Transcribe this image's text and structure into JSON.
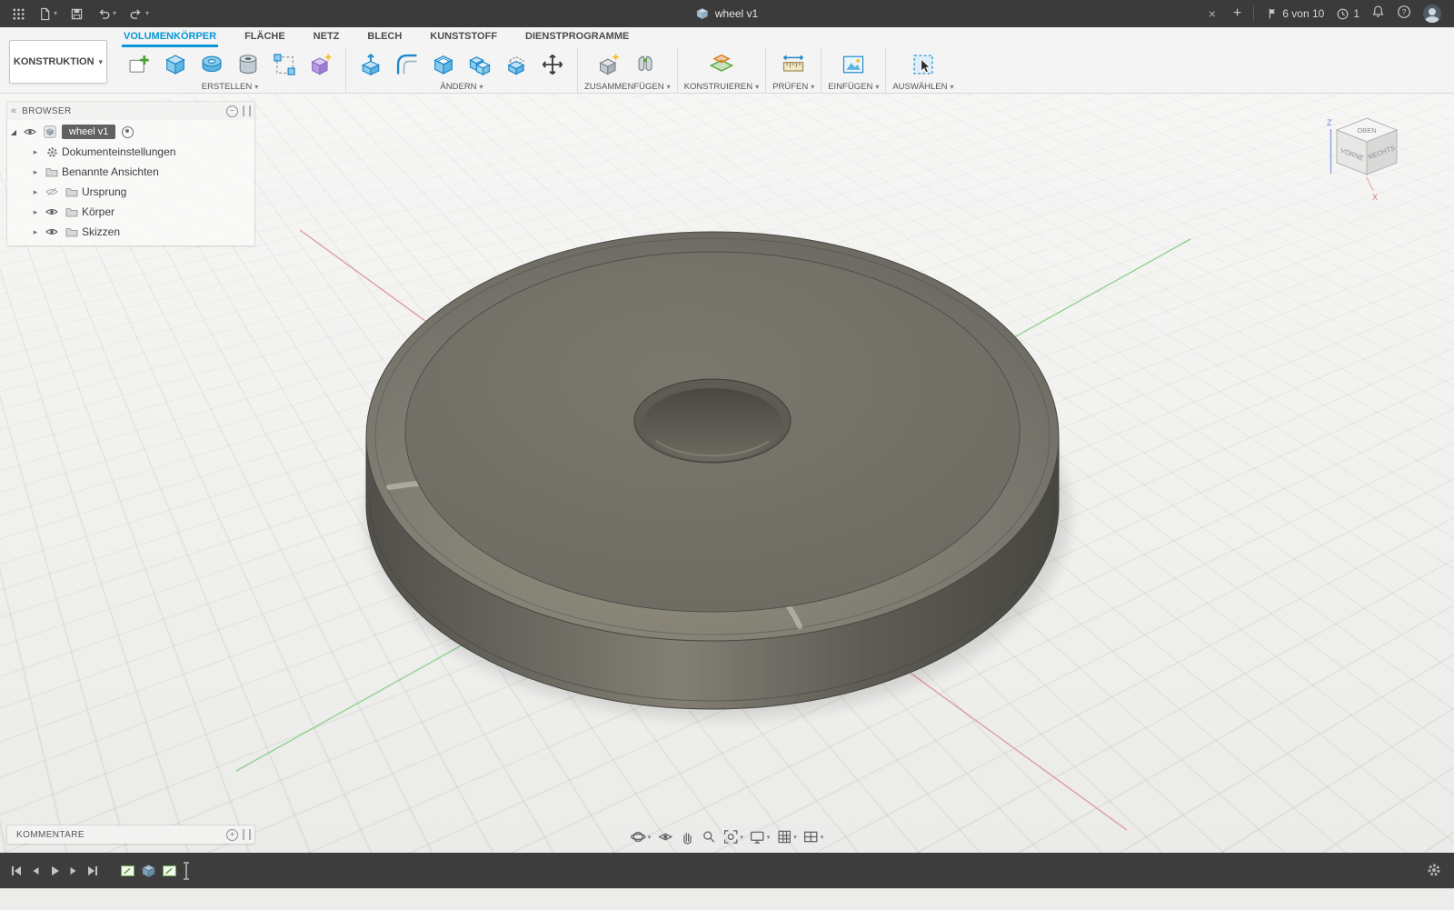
{
  "titlebar": {
    "tab_title": "wheel v1",
    "quota": "6 von 10",
    "jobs": "1"
  },
  "workspace": {
    "label": "KONSTRUKTION"
  },
  "ribbon": {
    "tabs": [
      {
        "label": "VOLUMENKÖRPER",
        "active": true
      },
      {
        "label": "FLÄCHE",
        "active": false
      },
      {
        "label": "NETZ",
        "active": false
      },
      {
        "label": "BLECH",
        "active": false
      },
      {
        "label": "KUNSTSTOFF",
        "active": false
      },
      {
        "label": "DIENSTPROGRAMME",
        "active": false
      }
    ],
    "groups": [
      {
        "label": "ERSTELLEN"
      },
      {
        "label": "ÄNDERN"
      },
      {
        "label": "ZUSAMMENFÜGEN"
      },
      {
        "label": "KONSTRUIEREN"
      },
      {
        "label": "PRÜFEN"
      },
      {
        "label": "EINFÜGEN"
      },
      {
        "label": "AUSWÄHLEN"
      }
    ]
  },
  "browser": {
    "title": "BROWSER",
    "root": "wheel v1",
    "items": [
      {
        "label": "Dokumenteinstellungen"
      },
      {
        "label": "Benannte Ansichten"
      },
      {
        "label": "Ursprung"
      },
      {
        "label": "Körper"
      },
      {
        "label": "Skizzen"
      }
    ]
  },
  "comments": {
    "title": "KOMMENTARE"
  },
  "viewcube": {
    "top": "OBEN",
    "front": "VORNE",
    "right": "RECHTS",
    "z": "Z",
    "x": "X"
  },
  "glyphs": {
    "caret": "▾",
    "collapse": "«",
    "expander": "▸",
    "expander_open": "◢",
    "close": "×",
    "new_tab": "+",
    "help": "?",
    "minus": "−",
    "plus": "+"
  }
}
